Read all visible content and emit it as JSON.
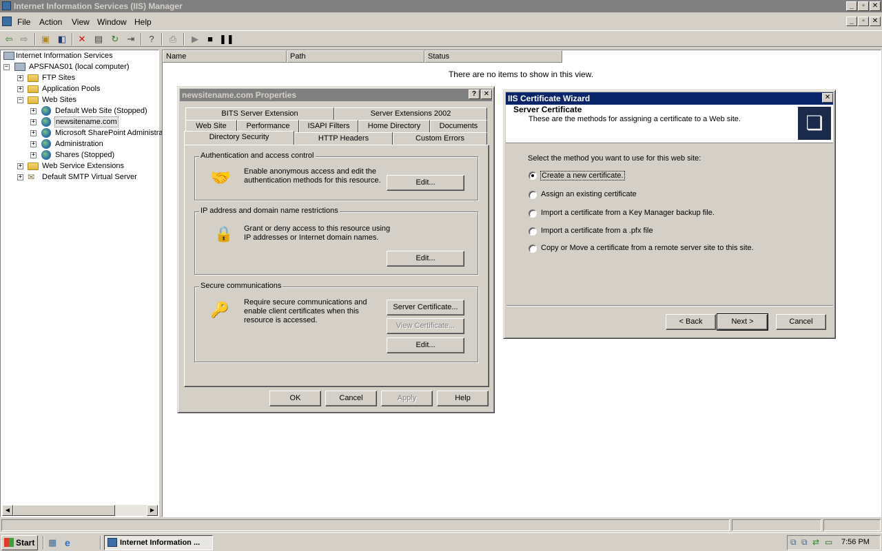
{
  "app": {
    "title": "Internet Information Services (IIS) Manager"
  },
  "menu": {
    "file": "File",
    "action": "Action",
    "view": "View",
    "window": "Window",
    "help": "Help"
  },
  "toolbar": {
    "icons": [
      "back-icon",
      "forward-icon",
      "up-folder-icon",
      "show-hide-tree-icon",
      "delete-icon",
      "properties-icon",
      "refresh-icon",
      "export-list-icon",
      "help-icon",
      "connect-icon",
      "start-icon",
      "stop-icon",
      "pause-icon"
    ]
  },
  "tree": {
    "root": "Internet Information Services",
    "computer": "APSFNAS01 (local computer)",
    "ftp": "FTP Sites",
    "app_pools": "Application Pools",
    "web_sites": "Web Sites",
    "default_site": "Default Web Site (Stopped)",
    "newsite": "newsitename.com",
    "sharepoint": "Microsoft SharePoint Administra",
    "administration": "Administration",
    "shares": "Shares (Stopped)",
    "web_ext": "Web Service Extensions",
    "smtp": "Default SMTP Virtual Server"
  },
  "list": {
    "columns": [
      "Name",
      "Path",
      "Status"
    ],
    "empty_text": "There are no items to show in this view."
  },
  "props": {
    "title": "newsitename.com Properties",
    "tabs_row1": [
      "BITS Server Extension",
      "Server Extensions 2002"
    ],
    "tabs_row2": [
      "Web Site",
      "Performance",
      "ISAPI Filters",
      "Home Directory",
      "Documents"
    ],
    "tabs_row3": [
      "Directory Security",
      "HTTP Headers",
      "Custom Errors"
    ],
    "auth": {
      "label": "Authentication and access control",
      "text1": "Enable anonymous access and edit the",
      "text2": "authentication methods for this resource.",
      "edit": "Edit..."
    },
    "ip": {
      "label": "IP address and domain name restrictions",
      "text1": "Grant or deny access to this resource using",
      "text2": "IP addresses or Internet domain names.",
      "edit": "Edit..."
    },
    "secure": {
      "label": "Secure communications",
      "text1": "Require secure communications and",
      "text2": "enable client certificates when this",
      "text3": "resource is accessed.",
      "server_cert": "Server Certificate...",
      "view_cert": "View Certificate...",
      "edit": "Edit..."
    },
    "buttons": {
      "ok": "OK",
      "cancel": "Cancel",
      "apply": "Apply",
      "help": "Help"
    }
  },
  "wizard": {
    "title": "IIS Certificate Wizard",
    "heading": "Server Certificate",
    "subheading": "These are the methods for assigning a certificate to a Web site.",
    "prompt": "Select the method you want to use for this web site:",
    "options": [
      "Create a new certificate.",
      "Assign an existing certificate",
      "Import a certificate from a Key Manager backup file.",
      "Import a certificate from a .pfx file",
      "Copy or Move a certificate from a remote server site to this site."
    ],
    "selected_option": 0,
    "back": "< Back",
    "next": "Next >",
    "cancel": "Cancel"
  },
  "taskbar": {
    "start": "Start",
    "task": "Internet Information ...",
    "clock": "7:56 PM"
  }
}
